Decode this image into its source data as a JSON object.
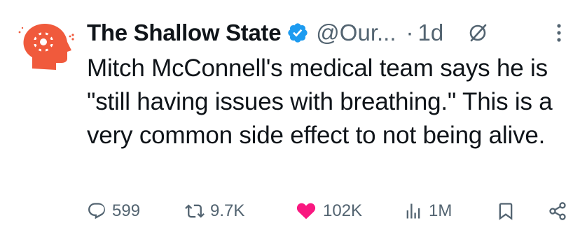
{
  "tweet": {
    "author_name": "The Shallow State",
    "handle": "@Our...",
    "separator": "·",
    "time": "1d",
    "text": "Mitch McConnell's medical team says he is \"still having issues with breathing.\" This is a very common side effect to not being alive.",
    "avatar_icon": "head-gear-icon",
    "avatar_color": "#f05a3c",
    "verified_color": "#1d9bf0",
    "like_color": "#f91880"
  },
  "actions": {
    "replies": "599",
    "reposts": "9.7K",
    "likes": "102K",
    "views": "1M"
  }
}
